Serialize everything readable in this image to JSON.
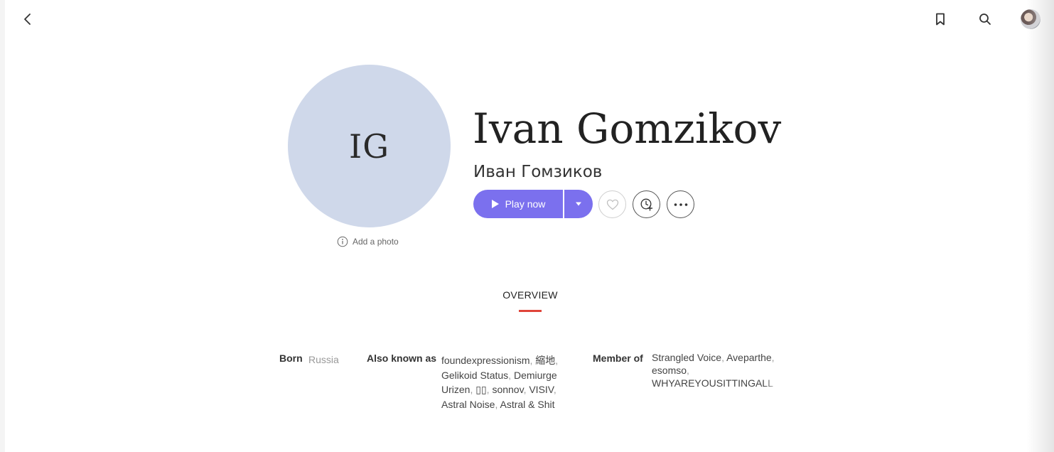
{
  "header": {
    "back_icon": "chevron-left-icon",
    "bookmark_icon": "bookmark-icon",
    "search_icon": "search-icon",
    "avatar_icon": "user-avatar"
  },
  "artist": {
    "initials": "IG",
    "name": "Ivan Gomzikov",
    "alt_name": "Иван Гомзиков",
    "add_photo_label": "Add a photo"
  },
  "actions": {
    "play_label": "Play now",
    "accent_color": "#7b70ee"
  },
  "tabs": [
    {
      "label": "OVERVIEW",
      "active": true,
      "underline_color": "#e0453a"
    }
  ],
  "details": {
    "born_label": "Born",
    "born_value": "Russia",
    "aka_label": "Also known as",
    "aka_values": [
      "foundexpressionism",
      "縮地",
      "Gelikoid Status",
      "Demiurge Urizen",
      "▯▯",
      "sonnov",
      "VISIV",
      "Astral Noise",
      "Astral & Shit"
    ],
    "member_label": "Member of",
    "member_values": [
      "Strangled Voice",
      "Aveparthe",
      "esomso",
      "WHYAREYOUSITTINGALL"
    ]
  }
}
